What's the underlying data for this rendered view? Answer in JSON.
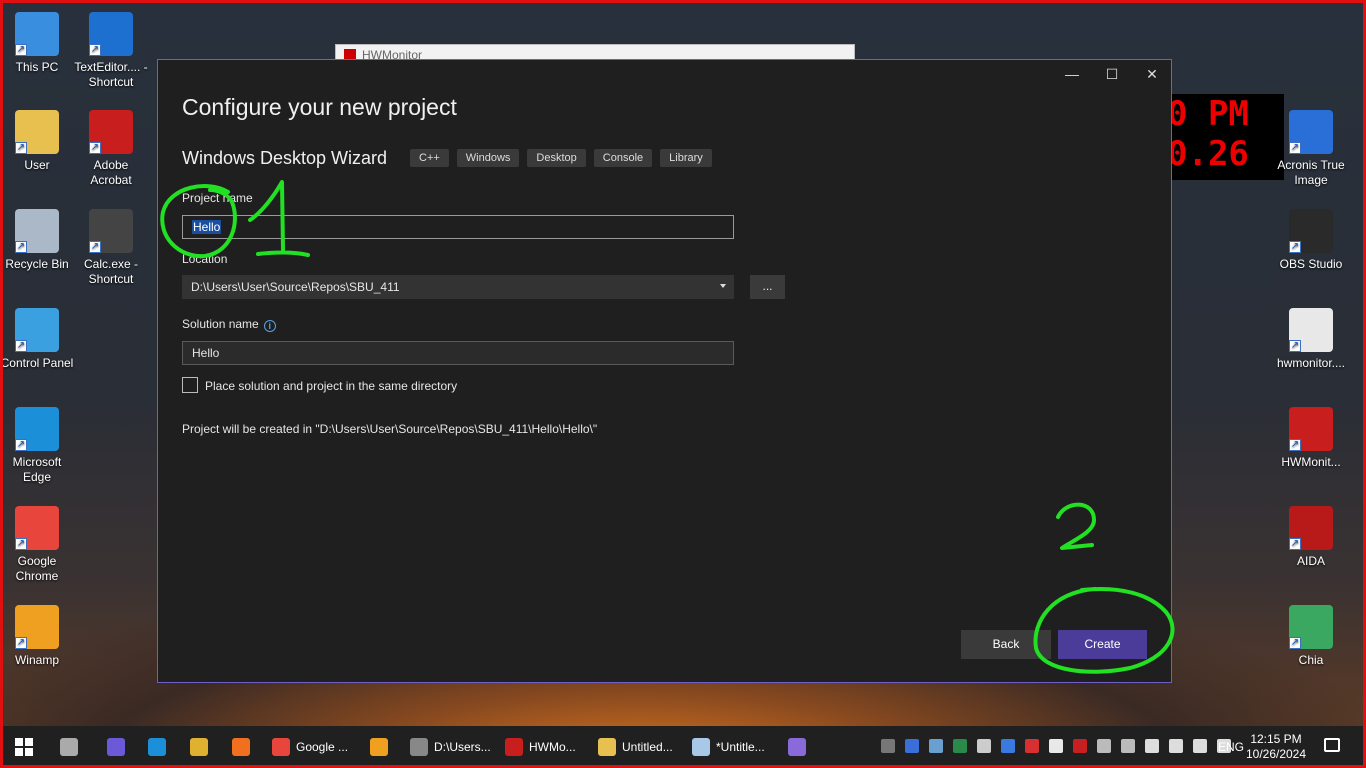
{
  "desktop": {
    "left_icons": [
      {
        "label": "This PC",
        "color": "#3a8ee0"
      },
      {
        "label": "TextEditor.... - Shortcut",
        "color": "#1d6fd0"
      },
      {
        "label": "User",
        "color": "#e8c050"
      },
      {
        "label": "Adobe Acrobat",
        "color": "#c81e1e"
      },
      {
        "label": "Recycle Bin",
        "color": "#aab8c8"
      },
      {
        "label": "Calc.exe - Shortcut",
        "color": "#444"
      },
      {
        "label": "Control Panel",
        "color": "#3aa0e0"
      },
      {
        "label": "Microsoft Edge",
        "color": "#1b8fd8"
      },
      {
        "label": "Google Chrome",
        "color": "#e8453c"
      },
      {
        "label": "Winamp",
        "color": "#f0a020"
      }
    ],
    "right_icons": [
      {
        "label": "Acronis True Image",
        "color": "#2a6ed8"
      },
      {
        "label": "OBS Studio",
        "color": "#2a2a2a"
      },
      {
        "label": "hwmonitor....",
        "color": "#e8e8e8"
      },
      {
        "label": "HWMonit...",
        "color": "#c81e1e"
      },
      {
        "label": "AIDA",
        "color": "#b81a1a"
      },
      {
        "label": "Chia",
        "color": "#3aa860"
      }
    ],
    "bg_window_title": "HWMonitor",
    "clock_widget": {
      "line1": "0 PM",
      "line2": "0.26"
    }
  },
  "dialog": {
    "title": "Configure your new project",
    "wizard_name": "Windows Desktop Wizard",
    "tags": [
      "C++",
      "Windows",
      "Desktop",
      "Console",
      "Library"
    ],
    "project_name_label": "Project name",
    "project_name_value": "Hello",
    "location_label": "Location",
    "location_value": "D:\\Users\\User\\Source\\Repos\\SBU_411",
    "browse_label": "...",
    "solution_name_label": "Solution name",
    "solution_name_value": "Hello",
    "same_dir_label": "Place solution and project in the same directory",
    "path_note": "Project will be created in \"D:\\Users\\User\\Source\\Repos\\SBU_411\\Hello\\Hello\\\"",
    "back_label": "Back",
    "create_label": "Create",
    "window_controls": {
      "minimize": "—",
      "maximize": "☐",
      "close": "✕"
    }
  },
  "annotations": {
    "mark1": "1",
    "mark2": "2",
    "color": "#22e022"
  },
  "taskbar": {
    "apps": [
      {
        "label": "",
        "color": "#aaa"
      },
      {
        "label": "",
        "color": "#6a5ad8"
      },
      {
        "label": "",
        "color": "#1b8fd8"
      },
      {
        "label": "",
        "color": "#e0b030"
      },
      {
        "label": "",
        "color": "#f07020"
      },
      {
        "label": "Google ...",
        "color": "#e8453c"
      },
      {
        "label": "",
        "color": "#f0a020"
      },
      {
        "label": "D:\\Users...",
        "color": "#888"
      },
      {
        "label": "HWMo...",
        "color": "#c81e1e"
      },
      {
        "label": "Untitled...",
        "color": "#e8c050"
      },
      {
        "label": "*Untitle...",
        "color": "#a8c8e8"
      },
      {
        "label": "",
        "color": "#8a6ad8"
      }
    ],
    "language": "ENG",
    "time": "12:15 PM",
    "date": "10/26/2024"
  }
}
